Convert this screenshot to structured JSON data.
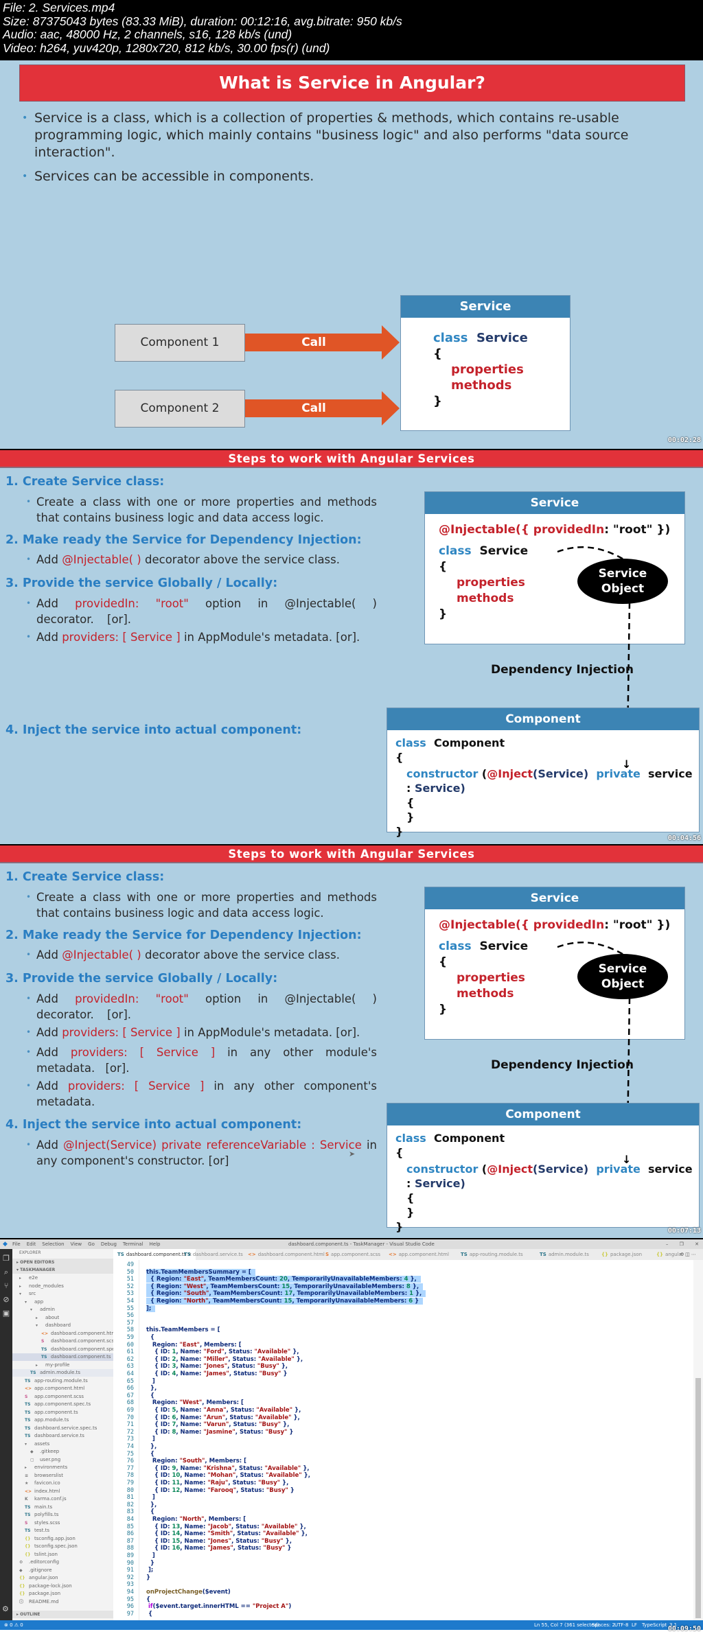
{
  "file_info": {
    "line1": "File: 2. Services.mp4",
    "line2": "Size: 87375043 bytes (83.33 MiB), duration: 00:12:16, avg.bitrate: 950 kb/s",
    "line3": "Audio: aac, 48000 Hz, 2 channels, s16, 128 kb/s (und)",
    "line4": "Video: h264, yuv420p, 1280x720, 812 kb/s, 30.00 fps(r) (und)"
  },
  "slide1": {
    "title": "What is Service in Angular?",
    "bullets": [
      "Service is a class, which is a collection of properties & methods, which contains re-usable programming logic, which mainly contains \"business logic\" and also performs \"data source interaction\".",
      "Services can be accessible in components."
    ],
    "component1": "Component 1",
    "component2": "Component 2",
    "call_label": "Call",
    "service_box": {
      "header": "Service",
      "kw_class": "class",
      "name": "Service",
      "open": "{",
      "properties": "properties",
      "methods": "methods",
      "close": "}"
    },
    "timestamp": "00:02:28"
  },
  "slide2": {
    "title": "Steps to work with Angular Services",
    "steps": [
      {
        "num": "1.",
        "title": "Create Service class:"
      },
      {
        "num": "2.",
        "title": "Make ready the Service for Dependency Injection:"
      },
      {
        "num": "3.",
        "title": "Provide the service Globally / Locally:"
      },
      {
        "num": "4.",
        "title": "Inject the service into actual component:"
      }
    ],
    "step1_point": "Create a class with one or more properties and methods that contains business logic and data access logic.",
    "step2_point": {
      "pre": "Add ",
      "red": "@Injectable( )",
      "post": " decorator above the service class."
    },
    "step3_point1": {
      "pre": "Add ",
      "red": "providedIn: \"root\"",
      "post": " option in @Injectable( ) decorator. [or]."
    },
    "step3_point2": {
      "pre": "Add ",
      "red": "providers: [ Service ]",
      "post": " in AppModule's metadata. [or]."
    },
    "timestamp": "00:04:56"
  },
  "slide3": {
    "title": "Steps to work with Angular Services",
    "step3_point3": {
      "pre": "Add ",
      "red": "providers: [ Service ]",
      "post": " in any other module's metadata. [or]."
    },
    "step3_point4": {
      "pre": "Add ",
      "red": "providers: [ Service ]",
      "post": " in any other component's metadata."
    },
    "step4_point": {
      "pre": "Add ",
      "red": "@Inject(Service) private referenceVariable : Service",
      "post": " in any component's constructor. [or]"
    },
    "timestamp": "00:07:13"
  },
  "di_diagram": {
    "service_header": "Service",
    "injectable": "@Injectable({",
    "provided_in": "providedIn",
    "root_str": ": \"root\" })",
    "kw_class": "class",
    "service_name": "Service",
    "open": "{",
    "properties": "properties",
    "methods": "methods",
    "close": "}",
    "oval_line1": "Service",
    "oval_line2": "Object",
    "di_label": "Dependency Injection",
    "component_header": "Component",
    "comp_kw_class": "class",
    "comp_name": "Component",
    "ctor": "constructor",
    "paren_open": "(",
    "inject": "@Inject",
    "inject_arg": "(Service)",
    "private": "private",
    "param": "service :",
    "param_type": "Service)",
    "inner_open": "{",
    "inner_close": "}",
    "outer_close": "}"
  },
  "vscode": {
    "window_title": "dashboard.component.ts - TaskManager - Visual Studio Code",
    "menu": [
      "File",
      "Edit",
      "Selection",
      "View",
      "Go",
      "Debug",
      "Terminal",
      "Help"
    ],
    "window_controls": [
      "–",
      "❐",
      "✕"
    ],
    "tabs": [
      {
        "icon": "TS",
        "label": "dashboard.component.ts",
        "active": true
      },
      {
        "icon": "TS",
        "label": "dashboard.service.ts"
      },
      {
        "icon": "<>",
        "label": "dashboard.component.html"
      },
      {
        "icon": "S",
        "label": "app.component.scss"
      },
      {
        "icon": "<>",
        "label": "app.component.html"
      },
      {
        "icon": "TS",
        "label": "app-routing.module.ts"
      },
      {
        "icon": "TS",
        "label": "admin.module.ts"
      },
      {
        "icon": "{}",
        "label": "package.json"
      },
      {
        "icon": "{}",
        "label": "angular"
      }
    ],
    "explorer_title": "EXPLORER",
    "open_editors": "OPEN EDITORS",
    "project": "TASKMANAGER",
    "outline": "OUTLINE",
    "tree": [
      {
        "d": 1,
        "icon": "▸",
        "label": "e2e"
      },
      {
        "d": 1,
        "icon": "▸",
        "label": "node_modules"
      },
      {
        "d": 1,
        "icon": "▾",
        "label": "src"
      },
      {
        "d": 2,
        "icon": "▾",
        "label": "app"
      },
      {
        "d": 3,
        "icon": "▾",
        "label": "admin"
      },
      {
        "d": 4,
        "icon": "▸",
        "label": "about"
      },
      {
        "d": 4,
        "icon": "▾",
        "label": "dashboard"
      },
      {
        "d": 5,
        "icon": "<>",
        "label": "dashboard.component.html"
      },
      {
        "d": 5,
        "icon": "S",
        "label": "dashboard.component.scss"
      },
      {
        "d": 5,
        "icon": "TS",
        "label": "dashboard.component.spec.ts"
      },
      {
        "d": 5,
        "icon": "TS",
        "label": "dashboard.component.ts",
        "selected": true
      },
      {
        "d": 4,
        "icon": "▸",
        "label": "my-profile"
      },
      {
        "d": 3,
        "icon": "TS",
        "label": "admin.module.ts",
        "hover": true
      },
      {
        "d": 2,
        "icon": "TS",
        "label": "app-routing.module.ts"
      },
      {
        "d": 2,
        "icon": "<>",
        "label": "app.component.html"
      },
      {
        "d": 2,
        "icon": "S",
        "label": "app.component.scss"
      },
      {
        "d": 2,
        "icon": "TS",
        "label": "app.component.spec.ts"
      },
      {
        "d": 2,
        "icon": "TS",
        "label": "app.component.ts"
      },
      {
        "d": 2,
        "icon": "TS",
        "label": "app.module.ts"
      },
      {
        "d": 2,
        "icon": "TS",
        "label": "dashboard.service.spec.ts"
      },
      {
        "d": 2,
        "icon": "TS",
        "label": "dashboard.service.ts"
      },
      {
        "d": 2,
        "icon": "▾",
        "label": "assets"
      },
      {
        "d": 3,
        "icon": "◆",
        "label": ".gitkeep"
      },
      {
        "d": 3,
        "icon": "▢",
        "label": "user.png"
      },
      {
        "d": 2,
        "icon": "▸",
        "label": "environments"
      },
      {
        "d": 2,
        "icon": "≡",
        "label": "browserslist"
      },
      {
        "d": 2,
        "icon": "★",
        "label": "favicon.ico"
      },
      {
        "d": 2,
        "icon": "<>",
        "label": "index.html"
      },
      {
        "d": 2,
        "icon": "K",
        "label": "karma.conf.js"
      },
      {
        "d": 2,
        "icon": "TS",
        "label": "main.ts"
      },
      {
        "d": 2,
        "icon": "TS",
        "label": "polyfills.ts"
      },
      {
        "d": 2,
        "icon": "S",
        "label": "styles.scss"
      },
      {
        "d": 2,
        "icon": "TS",
        "label": "test.ts"
      },
      {
        "d": 2,
        "icon": "{}",
        "label": "tsconfig.app.json"
      },
      {
        "d": 2,
        "icon": "{}",
        "label": "tsconfig.spec.json"
      },
      {
        "d": 2,
        "icon": "{}",
        "label": "tslint.json"
      },
      {
        "d": 1,
        "icon": "⚙",
        "label": ".editorconfig"
      },
      {
        "d": 1,
        "icon": "◆",
        "label": ".gitignore"
      },
      {
        "d": 1,
        "icon": "{}",
        "label": "angular.json"
      },
      {
        "d": 1,
        "icon": "{}",
        "label": "package-lock.json"
      },
      {
        "d": 1,
        "icon": "{}",
        "label": "package.json"
      },
      {
        "d": 1,
        "icon": "ⓘ",
        "label": "README.md"
      }
    ],
    "code_lines": [
      {
        "n": "49",
        "t": ""
      },
      {
        "n": "50",
        "t": "this.TeamMembersSummary = [",
        "sel": true
      },
      {
        "n": "51",
        "t": "  { Region: \"East\", TeamMembersCount: 20, TemporarilyUnavailableMembers: 4 },",
        "sel": true
      },
      {
        "n": "52",
        "t": "  { Region: \"West\", TeamMembersCount: 15, TemporarilyUnavailableMembers: 8 },",
        "sel": true
      },
      {
        "n": "53",
        "t": "  { Region: \"South\", TeamMembersCount: 17, TemporarilyUnavailableMembers: 1 },",
        "sel": true
      },
      {
        "n": "54",
        "t": "  { Region: \"North\", TeamMembersCount: 15, TemporarilyUnavailableMembers: 6 }",
        "sel": true
      },
      {
        "n": "55",
        "t": "];",
        "sel": true
      },
      {
        "n": "56",
        "t": ""
      },
      {
        "n": "57",
        "t": ""
      },
      {
        "n": "58",
        "t": "this.TeamMembers = ["
      },
      {
        "n": "59",
        "t": "  {"
      },
      {
        "n": "60",
        "t": "   Region: \"East\", Members: ["
      },
      {
        "n": "61",
        "t": "    { ID: 1, Name: \"Ford\", Status: \"Available\" },"
      },
      {
        "n": "62",
        "t": "    { ID: 2, Name: \"Miller\", Status: \"Available\" },"
      },
      {
        "n": "63",
        "t": "    { ID: 3, Name: \"Jones\", Status: \"Busy\" },"
      },
      {
        "n": "64",
        "t": "    { ID: 4, Name: \"James\", Status: \"Busy\" }"
      },
      {
        "n": "65",
        "t": "   ]"
      },
      {
        "n": "66",
        "t": "  },"
      },
      {
        "n": "67",
        "t": "  {"
      },
      {
        "n": "68",
        "t": "   Region: \"West\", Members: ["
      },
      {
        "n": "69",
        "t": "    { ID: 5, Name: \"Anna\", Status: \"Available\" },"
      },
      {
        "n": "70",
        "t": "    { ID: 6, Name: \"Arun\", Status: \"Available\" },"
      },
      {
        "n": "71",
        "t": "    { ID: 7, Name: \"Varun\", Status: \"Busy\" },"
      },
      {
        "n": "72",
        "t": "    { ID: 8, Name: \"Jasmine\", Status: \"Busy\" }"
      },
      {
        "n": "73",
        "t": "   ]"
      },
      {
        "n": "74",
        "t": "  },"
      },
      {
        "n": "75",
        "t": "  {"
      },
      {
        "n": "76",
        "t": "   Region: \"South\", Members: ["
      },
      {
        "n": "77",
        "t": "    { ID: 9, Name: \"Krishna\", Status: \"Available\" },"
      },
      {
        "n": "78",
        "t": "    { ID: 10, Name: \"Mohan\", Status: \"Available\" },"
      },
      {
        "n": "79",
        "t": "    { ID: 11, Name: \"Raju\", Status: \"Busy\" },"
      },
      {
        "n": "80",
        "t": "    { ID: 12, Name: \"Farooq\", Status: \"Busy\" }"
      },
      {
        "n": "81",
        "t": "   ]"
      },
      {
        "n": "82",
        "t": "  },"
      },
      {
        "n": "83",
        "t": "  {"
      },
      {
        "n": "84",
        "t": "   Region: \"North\", Members: ["
      },
      {
        "n": "85",
        "t": "    { ID: 13, Name: \"Jacob\", Status: \"Available\" },"
      },
      {
        "n": "86",
        "t": "    { ID: 14, Name: \"Smith\", Status: \"Available\" },"
      },
      {
        "n": "87",
        "t": "    { ID: 15, Name: \"Jones\", Status: \"Busy\" },"
      },
      {
        "n": "88",
        "t": "    { ID: 16, Name: \"James\", Status: \"Busy\" }"
      },
      {
        "n": "89",
        "t": "   ]"
      },
      {
        "n": "90",
        "t": "  }"
      },
      {
        "n": "91",
        "t": " ];"
      },
      {
        "n": "92",
        "t": "}"
      },
      {
        "n": "93",
        "t": ""
      },
      {
        "n": "94",
        "t": "onProjectChange($event)",
        "fn": true
      },
      {
        "n": "95",
        "t": "{"
      },
      {
        "n": "96",
        "t": " if($event.target.innerHTML == \"Project A\")"
      },
      {
        "n": "97",
        "t": " {"
      }
    ],
    "status_left": {
      "errors": "0",
      "warnings": "0"
    },
    "status_right": {
      "position": "Ln 55, Col 7 (361 selected)",
      "spaces": "Spaces: 2",
      "encoding": "UTF-8",
      "eol": "LF",
      "language": "TypeScript",
      "version": "3.1"
    },
    "timestamp": "00:09:50"
  },
  "colors": {
    "slide_bg": "#afcfe2",
    "banner_red": "#e2323a",
    "box_header_blue": "#3c84b4",
    "step_blue": "#2a7ec2",
    "code_red": "#c4222b",
    "arrow_orange": "#e05526",
    "vscode_status_blue": "#1e7acc"
  }
}
